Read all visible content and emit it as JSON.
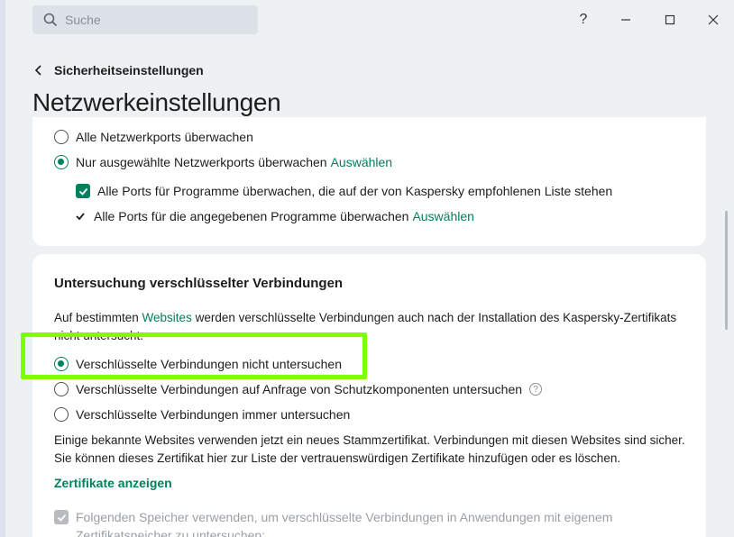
{
  "search": {
    "placeholder": "Suche"
  },
  "window": {
    "help": "?",
    "minimize": "—",
    "maximize": "☐",
    "close": "✕"
  },
  "breadcrumb": {
    "back_label": "Sicherheitseinstellungen"
  },
  "page": {
    "title": "Netzwerkeinstellungen"
  },
  "ports": {
    "radio_all": "Alle Netzwerkports überwachen",
    "radio_selected": "Nur ausgewählte Netzwerkports überwachen",
    "radio_selected_link": "Auswählen",
    "check_recommended": "Alle Ports für Programme überwachen, die auf der von Kaspersky empfohlenen Liste stehen",
    "tick_specified": "Alle Ports für die angegebenen Programme überwachen",
    "tick_specified_link": "Auswählen"
  },
  "encrypted": {
    "title": "Untersuchung verschlüsselter Verbindungen",
    "intro_before": "Auf bestimmten ",
    "intro_link": "Websites",
    "intro_after": " werden verschlüsselte Verbindungen auch nach der Installation des Kaspersky-Zertifikats nicht untersucht.",
    "option_none": "Verschlüsselte Verbindungen nicht untersuchen",
    "option_on_request": "Verschlüsselte Verbindungen auf Anfrage von Schutzkomponenten untersuchen",
    "option_always": "Verschlüsselte Verbindungen immer untersuchen",
    "selected": "option_none",
    "info": "Einige bekannte Websites verwenden jetzt ein neues Stammzertifikat. Verbindungen mit diesen Websites sind sicher. Sie können dieses Zertifikat hier zur Liste der vertrauenswürdigen Zertifikate hinzufügen oder es löschen.",
    "show_certs": "Zertifikate anzeigen",
    "store_check": "Folgenden Speicher verwenden, um verschlüsselte Verbindungen in Anwendungen mit eigenem Zertifikatspeicher zu untersuchen:"
  },
  "colors": {
    "accent": "#00805c",
    "highlight": "#7fff00"
  }
}
